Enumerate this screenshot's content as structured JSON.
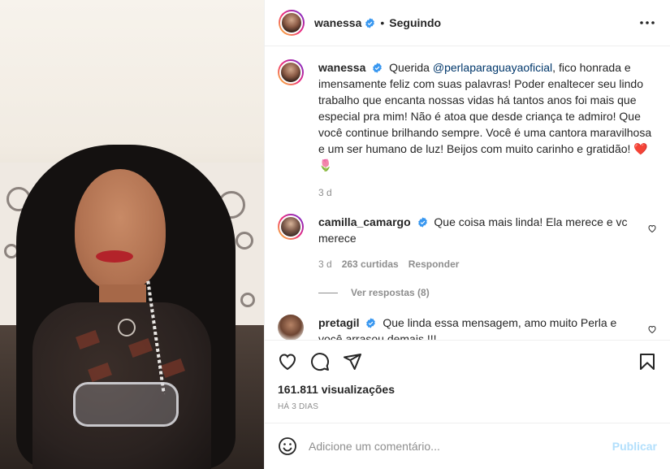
{
  "post": {
    "username": "wanessa",
    "follow_status": "Seguindo",
    "separator": "•"
  },
  "caption": {
    "username": "wanessa",
    "text_before": "Querida ",
    "mention": "@perlaparaguayaoficial",
    "text_after": ", fico honrada e imensamente feliz com suas palavras! Poder enaltecer seu lindo trabalho que encanta nossas vidas há tantos anos foi mais que especial pra mim! Não é atoa que desde criança te admiro! Que você continue brilhando sempre. Você é uma cantora maravilhosa e um ser humano de luz! Beijos com muito carinho e gratidão! ❤️ 🌷",
    "age": "3 d"
  },
  "comments": [
    {
      "username": "camilla_camargo",
      "text": "Que coisa mais linda! Ela merece e vc merece",
      "age": "3 d",
      "likes": "263 curtidas",
      "reply": "Responder",
      "view_replies": "Ver respostas (8)"
    },
    {
      "username": "pretagil",
      "text": "Que linda essa mensagem, amo muito Perla e você arrasou demais !!!"
    }
  ],
  "stats": {
    "views": "161.811 visualizações",
    "time_ago": "HÁ 3 DIAS"
  },
  "composer": {
    "placeholder": "Adicione um comentário...",
    "post_label": "Publicar"
  },
  "colors": {
    "verified": "#3897f0",
    "link": "#00376b",
    "muted": "#8e8e8e",
    "post_disabled": "#b2dffc"
  },
  "icons": {
    "heart": "heart-icon",
    "comment": "comment-icon",
    "share": "paper-plane-icon",
    "save": "bookmark-icon",
    "emoji": "emoji-icon",
    "more": "more-icon"
  }
}
